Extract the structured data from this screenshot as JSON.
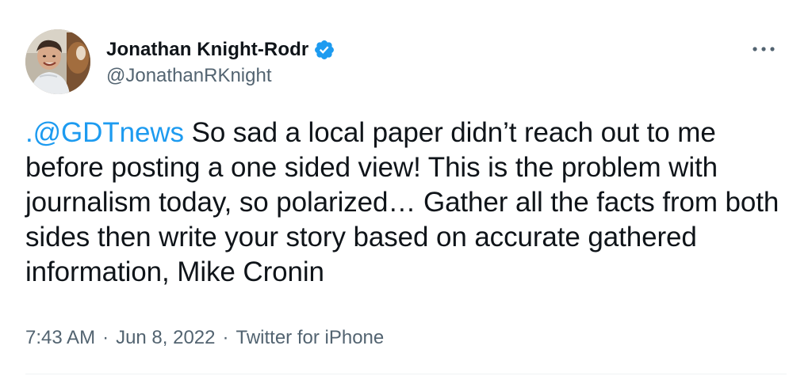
{
  "author": {
    "display_name": "Jonathan Knight-Rodr",
    "handle": "@JonathanRKnight",
    "verified": true
  },
  "tweet": {
    "mention": ".@GDTnews",
    "body": " So sad a local paper didn’t reach out to me before posting a one sided view! This is the problem with journalism today, so polarized… Gather all the facts from both sides then write your story based on accurate gathered information, Mike Cronin"
  },
  "meta": {
    "time": "7:43 AM",
    "separator": "·",
    "date": "Jun 8, 2022",
    "source": "Twitter for iPhone"
  },
  "colors": {
    "accent": "#1d9bf0",
    "secondary_text": "#536471",
    "primary_text": "#0f1419"
  },
  "icons": {
    "verified": "verified-badge-icon",
    "more": "more-dots-icon"
  }
}
